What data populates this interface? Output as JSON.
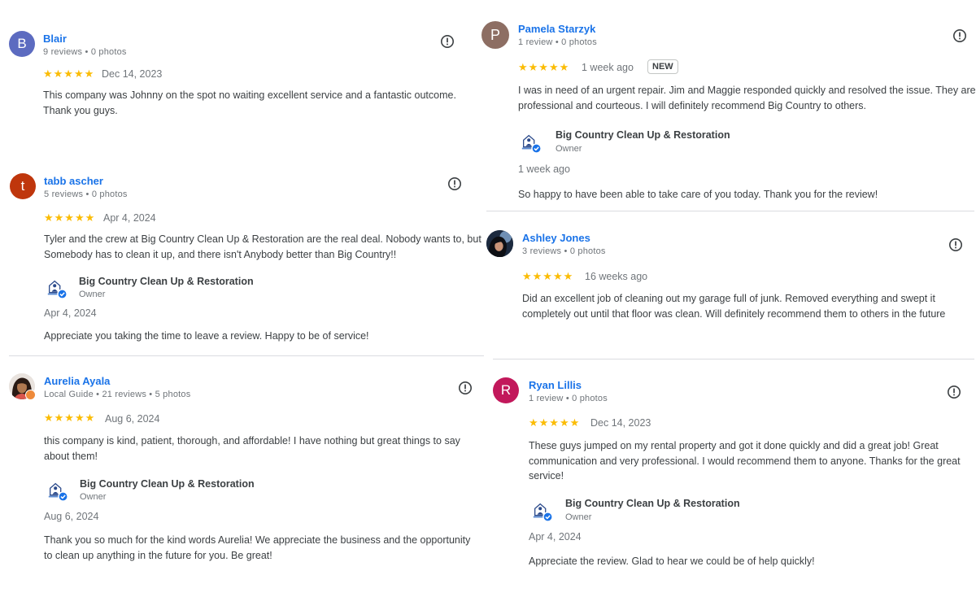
{
  "colors": {
    "star": "#fbbc04",
    "link": "#1a73e8",
    "divider": "#dadce0"
  },
  "reviews": [
    {
      "name": "Blair",
      "meta": "9 reviews • 0 photos",
      "initial": "B",
      "avatar_color": "#5c6bc0",
      "stars": "★★★★★",
      "rating": 5,
      "date": "Dec 14, 2023",
      "text": "This company was Johnny on the spot no waiting excellent service and a fantastic outcome. Thank you guys."
    },
    {
      "name": "tabb ascher",
      "meta": "5 reviews • 0 photos",
      "initial": "t",
      "avatar_color": "#bf360c",
      "stars": "★★★★★",
      "rating": 5,
      "date": "Apr 4, 2024",
      "text": "Tyler and the crew at Big Country Clean Up & Restoration are the real deal. Nobody wants to, but Somebody has to clean it up, and there isn't Anybody better than Big Country!!",
      "reply": {
        "owner": "Big Country Clean Up & Restoration",
        "role": "Owner",
        "date": "Apr 4, 2024",
        "text": "Appreciate you taking the time to leave a review. Happy to be of service!"
      }
    },
    {
      "name": "Aurelia Ayala",
      "meta": "Local Guide • 21 reviews • 5 photos",
      "stars": "★★★★★",
      "rating": 5,
      "date": "Aug 6, 2024",
      "text": "this company is kind, patient, thorough, and affordable! I have nothing but great things to say about them!",
      "reply": {
        "owner": "Big Country Clean Up & Restoration",
        "role": "Owner",
        "date": "Aug 6, 2024",
        "text": "Thank you so much for the kind words Aurelia! We appreciate the business and the opportunity to clean up anything in the future for you. Be great!"
      }
    },
    {
      "name": "Pamela Starzyk",
      "meta": "1 review • 0 photos",
      "initial": "P",
      "avatar_color": "#8d6e63",
      "stars": "★★★★★",
      "rating": 5,
      "date": "1 week ago",
      "badge": "NEW",
      "text": "I was in need of an urgent repair. Jim and Maggie responded quickly and resolved the issue. They are professional and courteous. I will definitely recommend Big Country to others.",
      "reply": {
        "owner": "Big Country Clean Up & Restoration",
        "role": "Owner",
        "date": "1 week ago",
        "text": "So happy to have been able to take care of you today. Thank you for the review!"
      }
    },
    {
      "name": "Ashley Jones",
      "meta": "3 reviews • 0 photos",
      "stars": "★★★★★",
      "rating": 5,
      "date": "16 weeks ago",
      "text": "Did an excellent job of cleaning out my garage full of junk. Removed everything and swept it completely out until that floor was clean. Will definitely recommend them to others in the future"
    },
    {
      "name": "Ryan Lillis",
      "meta": "1 review • 0 photos",
      "initial": "R",
      "avatar_color": "#c2185b",
      "stars": "★★★★★",
      "rating": 5,
      "date": "Dec 14, 2023",
      "text": "These guys jumped on my rental property and got it done quickly and did a great job! Great communication and very professional. I would recommend them to anyone. Thanks for the great service!",
      "reply": {
        "owner": "Big Country Clean Up & Restoration",
        "role": "Owner",
        "date": "Apr 4, 2024",
        "text": "Appreciate the review. Glad to hear we could be of help quickly!"
      }
    }
  ]
}
